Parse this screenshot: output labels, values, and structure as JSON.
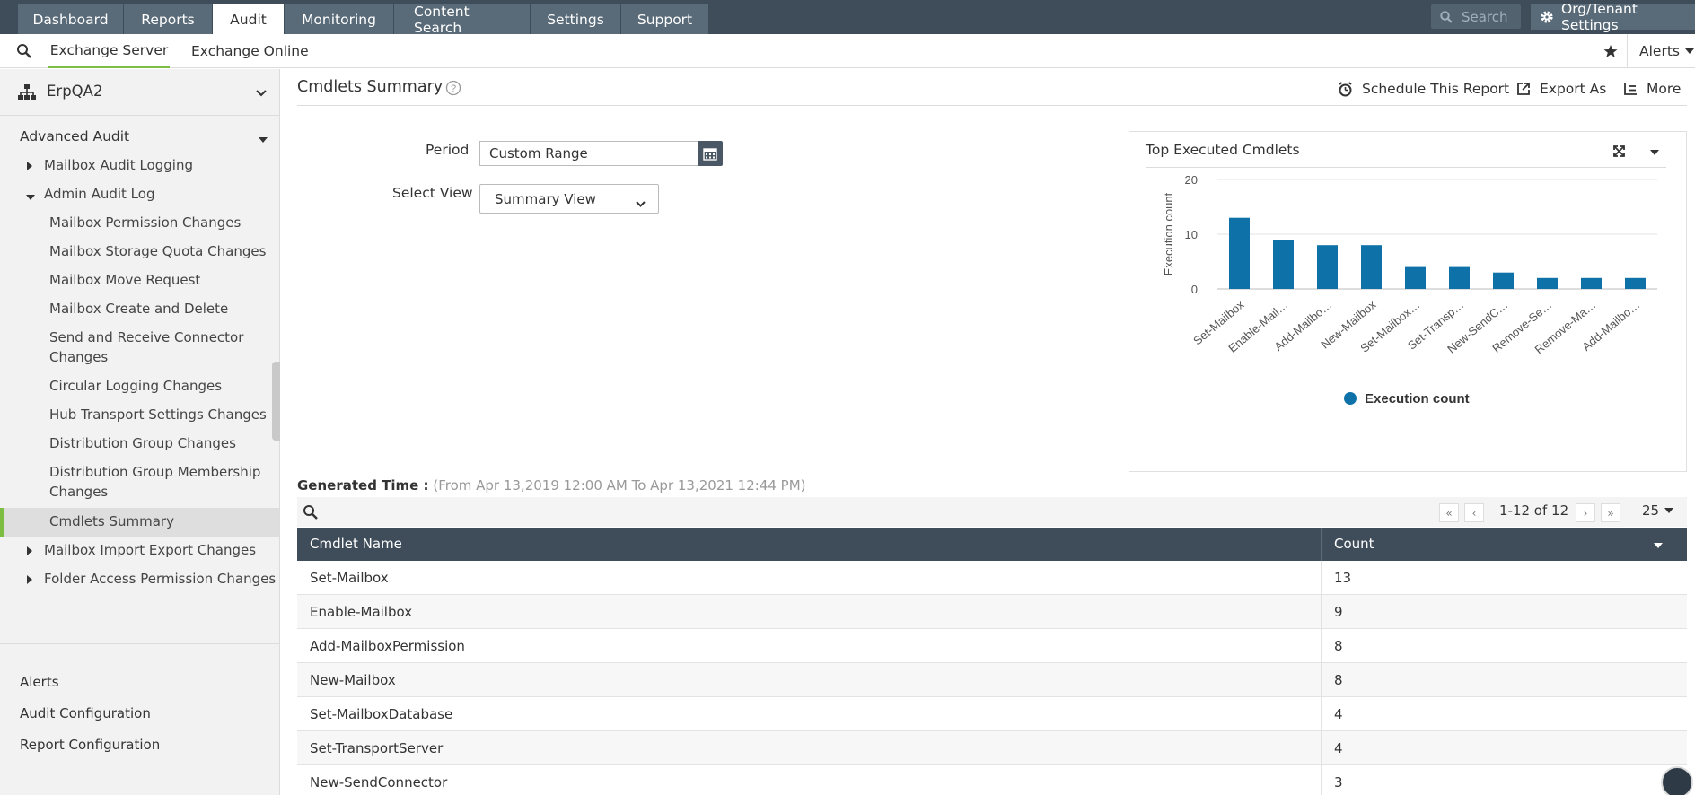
{
  "top_tabs": [
    "Dashboard",
    "Reports",
    "Audit",
    "Monitoring",
    "Content Search",
    "Settings",
    "Support"
  ],
  "active_top_tab": "Audit",
  "top_search_placeholder": "Search",
  "org_settings_label": "Org/Tenant Settings",
  "sub_tabs": [
    "Exchange Server",
    "Exchange Online"
  ],
  "active_sub_tab": "Exchange Server",
  "alerts_top_label": "Alerts",
  "sidebar": {
    "tenant": "ErpQA2",
    "section": "Advanced Audit",
    "groups": [
      "Mailbox Audit Logging",
      "Admin Audit Log"
    ],
    "admin_items": [
      "Mailbox Permission Changes",
      "Mailbox Storage Quota Changes",
      "Mailbox Move Request",
      "Mailbox Create and Delete",
      "Send and Receive Connector Changes",
      "Circular Logging Changes",
      "Hub Transport Settings Changes",
      "Distribution Group Changes",
      "Distribution Group Membership Changes",
      "Cmdlets Summary"
    ],
    "active_item": "Cmdlets Summary",
    "more_groups": [
      "Mailbox Import Export Changes",
      "Folder Access Permission Changes"
    ],
    "footer": [
      "Alerts",
      "Audit Configuration",
      "Report Configuration"
    ]
  },
  "page": {
    "title": "Cmdlets Summary",
    "actions": [
      "Schedule This Report",
      "Export As",
      "More"
    ],
    "period_label": "Period",
    "period_value": "Custom Range",
    "view_label": "Select View",
    "view_value": "Summary View",
    "generated_label": "Generated Time :",
    "generated_range": "(From Apr 13,2019 12:00 AM To Apr 13,2021 12:44 PM)"
  },
  "chart_data": {
    "type": "bar",
    "title": "Top Executed Cmdlets",
    "ylabel": "Execution count",
    "xlabel": "",
    "categories": [
      "Set-Mailbox",
      "Enable-Mail…",
      "Add-Mailbo…",
      "New-Mailbox",
      "Set-Mailbox…",
      "Set-Transp…",
      "New-SendC…",
      "Remove-Se…",
      "Remove-Ma…",
      "Add-Mailbo…"
    ],
    "series": [
      {
        "name": "Execution count",
        "values": [
          13,
          9,
          8,
          8,
          4,
          4,
          3,
          2,
          2,
          2
        ]
      }
    ],
    "ylim": [
      0,
      20
    ],
    "yticks": [
      0,
      10,
      20
    ],
    "color": "#0e72a8",
    "legend_position": "bottom",
    "grid": true
  },
  "table": {
    "columns": [
      "Cmdlet Name",
      "Count"
    ],
    "pagination": "1-12 of 12",
    "page_size": "25",
    "rows": [
      [
        "Set-Mailbox",
        "13"
      ],
      [
        "Enable-Mailbox",
        "9"
      ],
      [
        "Add-MailboxPermission",
        "8"
      ],
      [
        "New-Mailbox",
        "8"
      ],
      [
        "Set-MailboxDatabase",
        "4"
      ],
      [
        "Set-TransportServer",
        "4"
      ],
      [
        "New-SendConnector",
        "3"
      ]
    ]
  }
}
